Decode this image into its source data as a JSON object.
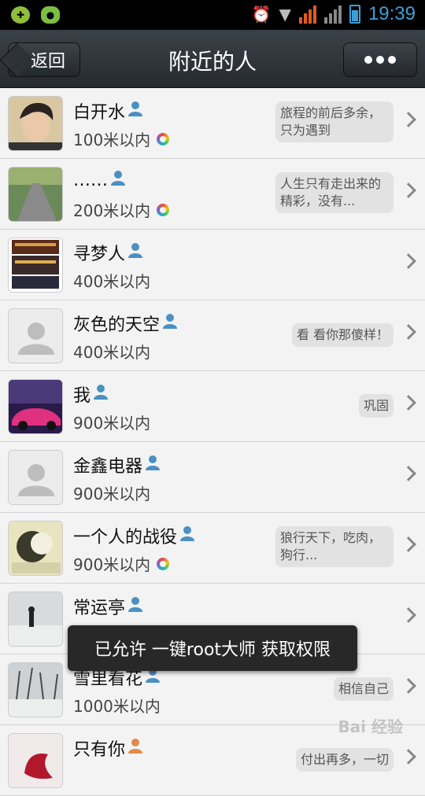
{
  "status_bar": {
    "time": "19:39",
    "icons": [
      "app-icon-green",
      "wechat-icon",
      "alarm-icon",
      "wifi-icon",
      "signal-icon",
      "battery-icon"
    ]
  },
  "header": {
    "back_label": "返回",
    "title": "附近的人",
    "more_icon": "more-dots-icon"
  },
  "list": [
    {
      "name": "白开水",
      "distance": "100米以内",
      "status": "旅程的前后多余，只为遇到",
      "gender": "male",
      "ring": true,
      "avatar": "face"
    },
    {
      "name": "……",
      "distance": "200米以内",
      "status": "人生只有走出来的精彩，没有...",
      "gender": "male",
      "ring": true,
      "avatar": "road"
    },
    {
      "name": "寻梦人",
      "distance": "400米以内",
      "status": "",
      "gender": "male",
      "ring": false,
      "avatar": "collage"
    },
    {
      "name": "灰色的天空",
      "distance": "400米以内",
      "status": "看 看你那傻样！",
      "gender": "male",
      "ring": false,
      "avatar": "default"
    },
    {
      "name": "我",
      "distance": "900米以内",
      "status": "巩固",
      "gender": "male",
      "ring": false,
      "avatar": "car"
    },
    {
      "name": "金鑫电器",
      "distance": "900米以内",
      "status": "",
      "gender": "male",
      "ring": false,
      "avatar": "default"
    },
    {
      "name": "一个人的战役",
      "distance": "900米以内",
      "status": "狼行天下，吃肉，狗行...",
      "gender": "male",
      "ring": true,
      "avatar": "cartoon"
    },
    {
      "name": "常运亭",
      "distance": "",
      "status": "",
      "gender": "male",
      "ring": false,
      "avatar": "snow"
    },
    {
      "name": "雪里看花",
      "distance": "1000米以内",
      "status": "相信自己",
      "gender": "male",
      "ring": false,
      "avatar": "trees"
    },
    {
      "name": "只有你",
      "distance": "",
      "status": "付出再多，一切",
      "gender": "female",
      "ring": false,
      "avatar": "flower"
    }
  ],
  "toast": "已允许 一键root大师 获取权限",
  "watermark": "Bai 经验",
  "colors": {
    "accent": "#3aa0d8",
    "male": "#4a90c2",
    "female": "#e08a4a"
  }
}
